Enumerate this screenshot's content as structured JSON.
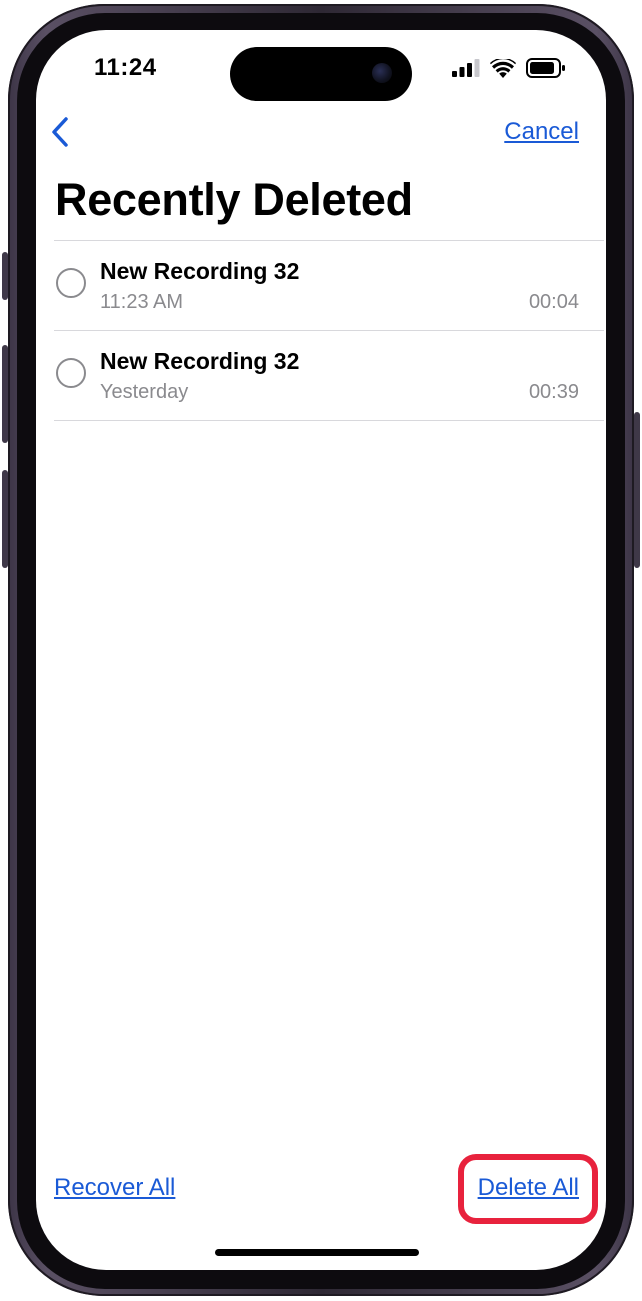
{
  "status_bar": {
    "time": "11:24",
    "icons": [
      "signal-icon",
      "wifi-icon",
      "battery-icon"
    ]
  },
  "nav": {
    "back_icon": "chevron-left-icon",
    "cancel_label": "Cancel"
  },
  "title": "Recently Deleted",
  "recordings": [
    {
      "name": "New Recording 32",
      "date": "11:23 AM",
      "duration": "00:04",
      "selected": false
    },
    {
      "name": "New Recording 32",
      "date": "Yesterday",
      "duration": "00:39",
      "selected": false
    }
  ],
  "footer": {
    "recover_all_label": "Recover All",
    "delete_all_label": "Delete All"
  },
  "colors": {
    "accent": "#1a5ad6",
    "highlight": "#e8223d",
    "secondary_text": "#8a8a8e"
  }
}
